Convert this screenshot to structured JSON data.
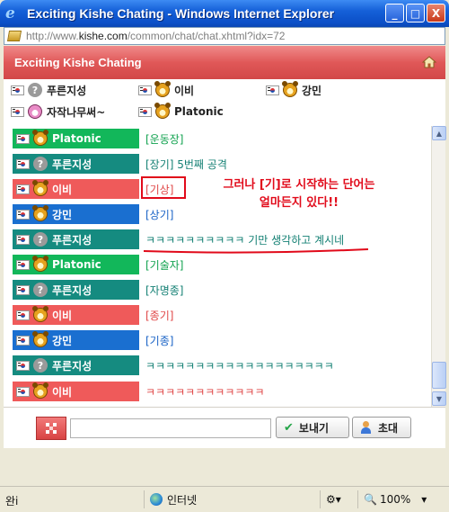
{
  "window": {
    "title": "Exciting Kishe Chating - Windows Internet Explorer",
    "minimize_glyph": "_",
    "maximize_glyph": "□",
    "close_glyph": "X"
  },
  "address": {
    "prefix": "http://www.",
    "domain": "kishe.com",
    "path": "/common/chat/chat.xhtml?idx=72"
  },
  "header": {
    "title": "Exciting Kishe Chating",
    "home_icon": "home-icon"
  },
  "users": [
    {
      "name": "푸른지성",
      "avatar": "q"
    },
    {
      "name": "이비",
      "avatar": "bear"
    },
    {
      "name": "강민",
      "avatar": "bear"
    },
    {
      "name": "자작나무써~",
      "avatar": "pink"
    },
    {
      "name": "Platonic",
      "avatar": "bear"
    }
  ],
  "messages": [
    {
      "name": "Platonic",
      "color": "green",
      "text": "[운동장]"
    },
    {
      "name": "푸른지성",
      "color": "teal",
      "text": "[장기] 5번째 공격"
    },
    {
      "name": "이비",
      "color": "red",
      "text": "[기상]"
    },
    {
      "name": "강민",
      "color": "blue",
      "text": "[상기]"
    },
    {
      "name": "푸른지성",
      "color": "teal",
      "text": "ㅋㅋㅋㅋㅋㅋㅋㅋㅋㅋ 기만 생각하고 계시네"
    },
    {
      "name": "Platonic",
      "color": "green",
      "text": "[기술자]"
    },
    {
      "name": "푸른지성",
      "color": "teal",
      "text": "[자명종]"
    },
    {
      "name": "이비",
      "color": "red",
      "text": "[종기]"
    },
    {
      "name": "강민",
      "color": "blue",
      "text": "[기종]"
    },
    {
      "name": "푸른지성",
      "color": "teal",
      "text": "ㅋㅋㅋㅋㅋㅋㅋㅋㅋㅋㅋㅋㅋㅋㅋㅋㅋㅋㅋ"
    },
    {
      "name": "이비",
      "color": "red",
      "text": "ㅋㅋㅋㅋㅋㅋㅋㅋㅋㅋㅋㅋ"
    }
  ],
  "annotation": {
    "line1": "그러나 [기]로 시작하는 단어는",
    "line2": "얼마든지 있다!!"
  },
  "input": {
    "value": "",
    "placeholder": ""
  },
  "buttons": {
    "send": "보내기",
    "invite": "초대"
  },
  "status": {
    "left": "완i",
    "zone": "인터넷",
    "zoom": "100%"
  }
}
